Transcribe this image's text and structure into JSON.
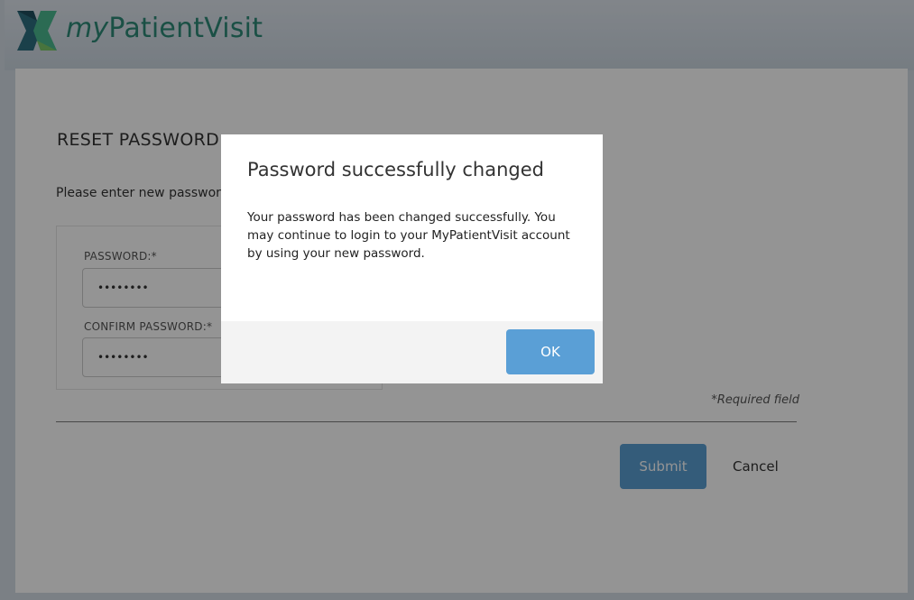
{
  "header": {
    "logo_prefix": "my",
    "logo_suffix": "PatientVisit"
  },
  "form": {
    "title": "RESET PASSWORD",
    "instruction": "Please enter new password",
    "password_label": "PASSWORD:*",
    "password_value": "••••••••",
    "confirm_label": "CONFIRM PASSWORD:*",
    "confirm_value": "••••••••",
    "required_note": "*Required field",
    "submit_label": "Submit",
    "cancel_label": "Cancel"
  },
  "modal": {
    "title": "Password successfully changed",
    "body": "Your password has been changed successfully. You may continue to login to your MyPatientVisit account by using your new password.",
    "ok_label": "OK"
  },
  "colors": {
    "brand_teal": "#2e8a78",
    "button_blue": "#5a9fd6",
    "overlay": "rgba(0,0,0,0.42)"
  }
}
